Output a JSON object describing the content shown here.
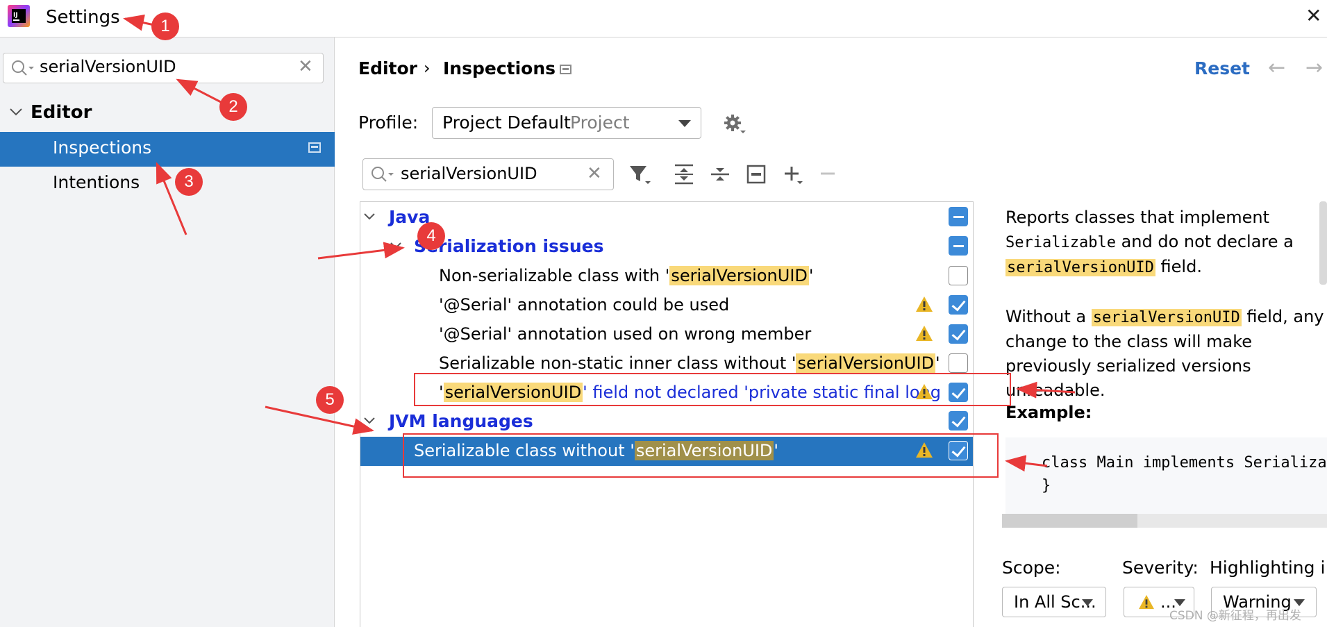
{
  "window": {
    "title": "Settings"
  },
  "sidebar": {
    "search_value": "serialVersionUID",
    "tree": [
      {
        "label": "Editor"
      },
      {
        "label": "Inspections"
      },
      {
        "label": "Intentions"
      }
    ]
  },
  "header": {
    "breadcrumb": [
      "Editor",
      "Inspections"
    ],
    "breadcrumb_sep": "›",
    "reset_label": "Reset",
    "back_glyph": "←",
    "forward_glyph": "→"
  },
  "profile": {
    "label": "Profile:",
    "name": "Project Default",
    "scope": "Project"
  },
  "filter": {
    "search_value": "serialVersionUID"
  },
  "inspections": {
    "group_java": "Java",
    "group_serialization": "Serialization issues",
    "items": [
      {
        "pre": "Non-serializable class with '",
        "hl": "serialVersionUID",
        "post": "'",
        "warn": false,
        "checked": false
      },
      {
        "pre": "",
        "hl": "",
        "post": "'@Serial' annotation could be used",
        "warn": true,
        "checked": true
      },
      {
        "pre": "",
        "hl": "",
        "post": "'@Serial' annotation used on wrong member",
        "warn": true,
        "checked": true
      },
      {
        "pre": "Serializable non-static inner class without '",
        "hl": "serialVersionUID",
        "post": "'",
        "warn": false,
        "checked": false
      },
      {
        "pre": "'",
        "hl": "serialVersionUID",
        "post": "' field not declared 'private static final long",
        "warn": true,
        "checked": true
      }
    ],
    "group_jvm": "JVM languages",
    "selected_item": {
      "pre": "Serializable class without '",
      "hl": "serialVersionUID",
      "post": "'",
      "warn": true,
      "checked": true
    }
  },
  "description": {
    "p1_a": "Reports classes that implement ",
    "p1_code1": "Serializable",
    "p1_b": " and do not declare a ",
    "p1_code2": "serialVersionUID",
    "p1_c": " field.",
    "p2_a": "Without a ",
    "p2_code": "serialVersionUID",
    "p2_b": " field, any change to the class will make previously serialized versions unreadable.",
    "example_label": "Example:",
    "code_line1": "class Main implements Serializable {",
    "code_line2": "}"
  },
  "options": {
    "scope_label": "Scope:",
    "scope_value": "In All Sc...",
    "severity_label": "Severity:",
    "severity_value": "...",
    "highlighting_label": "Highlighting i",
    "highlighting_value": "Warning"
  },
  "annotations": [
    "1",
    "2",
    "3",
    "4",
    "5"
  ],
  "watermark": "CSDN @新征程，再出发",
  "colors": {
    "selection": "#2675bf",
    "highlight": "#f9d97a",
    "group_text": "#1a2ed8",
    "annotation_red": "#e83a3a",
    "checkbox_on": "#3c8ad8",
    "warning": "#e9b626"
  }
}
